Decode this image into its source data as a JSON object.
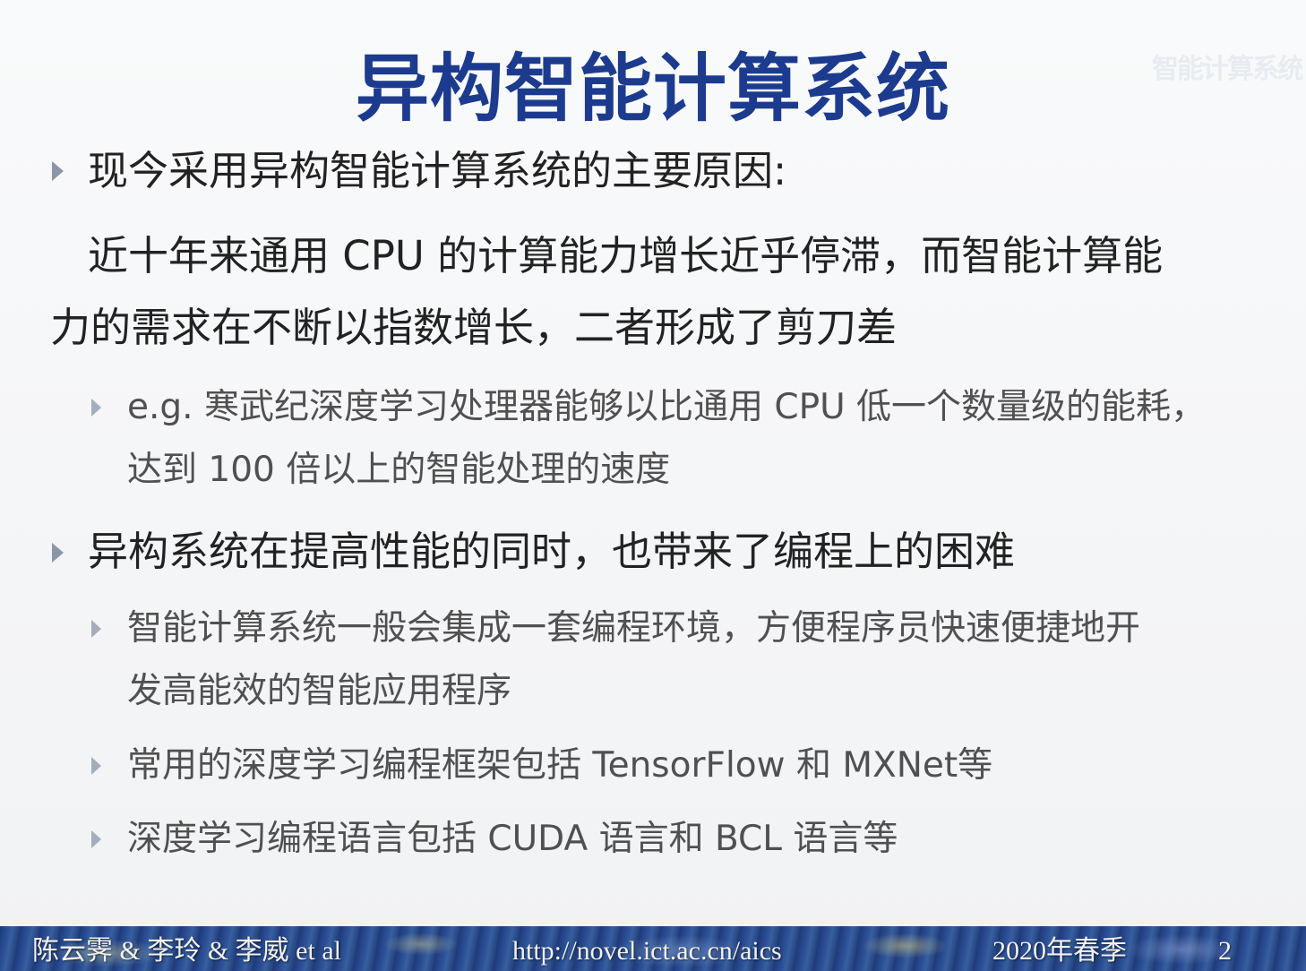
{
  "slide": {
    "title": "异构智能计算系统",
    "watermark": "智能计算系统",
    "bullets": [
      {
        "heading": "现今采用异构智能计算系统的主要原因:",
        "body_line1": "近十年来通用 CPU 的计算能力增长近乎停滞，而智能计算能",
        "body_line2": "力的需求在不断以指数增长，二者形成了剪刀差",
        "sub": [
          {
            "line1": "e.g. 寒武纪深度学习处理器能够以比通用 CPU 低一个数量级的能耗，",
            "line2": "达到 100 倍以上的智能处理的速度"
          }
        ]
      },
      {
        "heading": "异构系统在提高性能的同时，也带来了编程上的困难",
        "sub": [
          {
            "line1": "智能计算系统一般会集成一套编程环境，方便程序员快速便捷地开",
            "line2": "发高能效的智能应用程序"
          },
          {
            "line1": "常用的深度学习编程框架包括 TensorFlow 和 MXNet等"
          },
          {
            "line1": "深度学习编程语言包括 CUDA 语言和 BCL 语言等"
          }
        ]
      }
    ]
  },
  "footer": {
    "authors": "陈云霁 & 李玲 & 李威 et al",
    "url": "http://novel.ict.ac.cn/aics",
    "term": "2020年春季",
    "page": "2"
  },
  "colors": {
    "title": "#1d3b8e",
    "text": "#222222",
    "subtext": "#505050",
    "bullet": "#8b97a8",
    "footer_bg": "#24417f"
  }
}
